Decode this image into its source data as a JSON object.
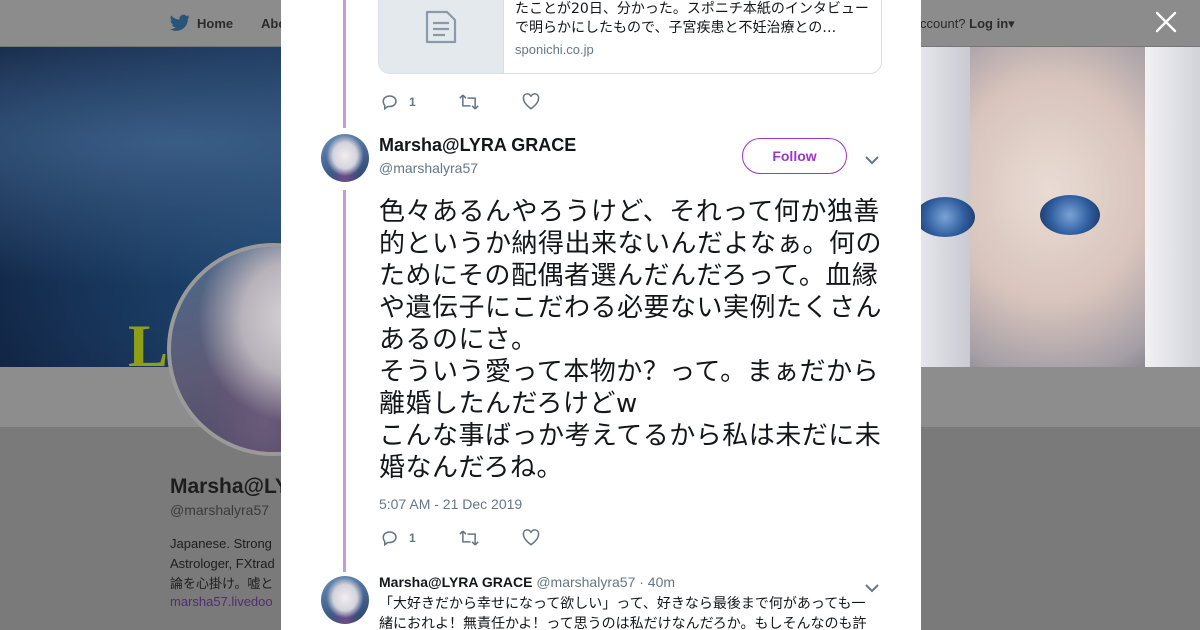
{
  "nav": {
    "home_label": "Home",
    "about_label": "Abo",
    "account_question": "ccount?",
    "login_label": "Log in"
  },
  "profile_bg": {
    "banner_letter": "L",
    "name": "Marsha@LY",
    "handle": "@marshalyra57",
    "bio_lines": [
      "Japanese. Strong",
      "Astrologer, FXtrad",
      "論を心掛け。嘘と"
    ],
    "link": "marsha57.livedoo"
  },
  "modal": {
    "prev_tweet": {
      "card_description": "たことが20日、分かった。スポニチ本紙のインタビューで明らかにしたもので、子宮疾患と不妊治療との…",
      "card_domain": "sponichi.co.jp",
      "reply_count": "1"
    },
    "main_tweet": {
      "author_name": "Marsha@LYRA GRACE",
      "author_handle": "@marshalyra57",
      "follow_label": "Follow",
      "text": "色々あるんやろうけど、それって何か独善的というか納得出来ないんだよなぁ。何のためにその配偶者選んだんだろって。血縁や遺伝子にこだわる必要ない実例たくさんあるのにさ。\nそういう愛って本物か？って。まぁだから離婚したんだろけどw\nこんな事ばっか考えてるから私は未だに未婚なんだろね。",
      "timestamp": "5:07 AM - 21 Dec 2019",
      "reply_count": "1"
    },
    "next_tweet": {
      "author_name": "Marsha@LYRA GRACE",
      "author_handle": "@marshalyra57",
      "time": "· 40m",
      "text": "「大好きだから幸せになって欲しい」って、好きなら最後まで何があっても一緒におれよ！無責任かよ！って思うのは私だけなんだろか。もしそんなのも許"
    }
  },
  "colors": {
    "accent": "#9b36c9",
    "thread_line": "#c79ae0",
    "muted_text": "#657786",
    "overlay": "#7a7a7a"
  },
  "icons": {
    "close": "close-icon",
    "reply": "reply-icon",
    "retweet": "retweet-icon",
    "like": "heart-icon",
    "chevron": "chevron-down-icon",
    "bird": "twitter-bird-icon",
    "document": "document-icon"
  }
}
